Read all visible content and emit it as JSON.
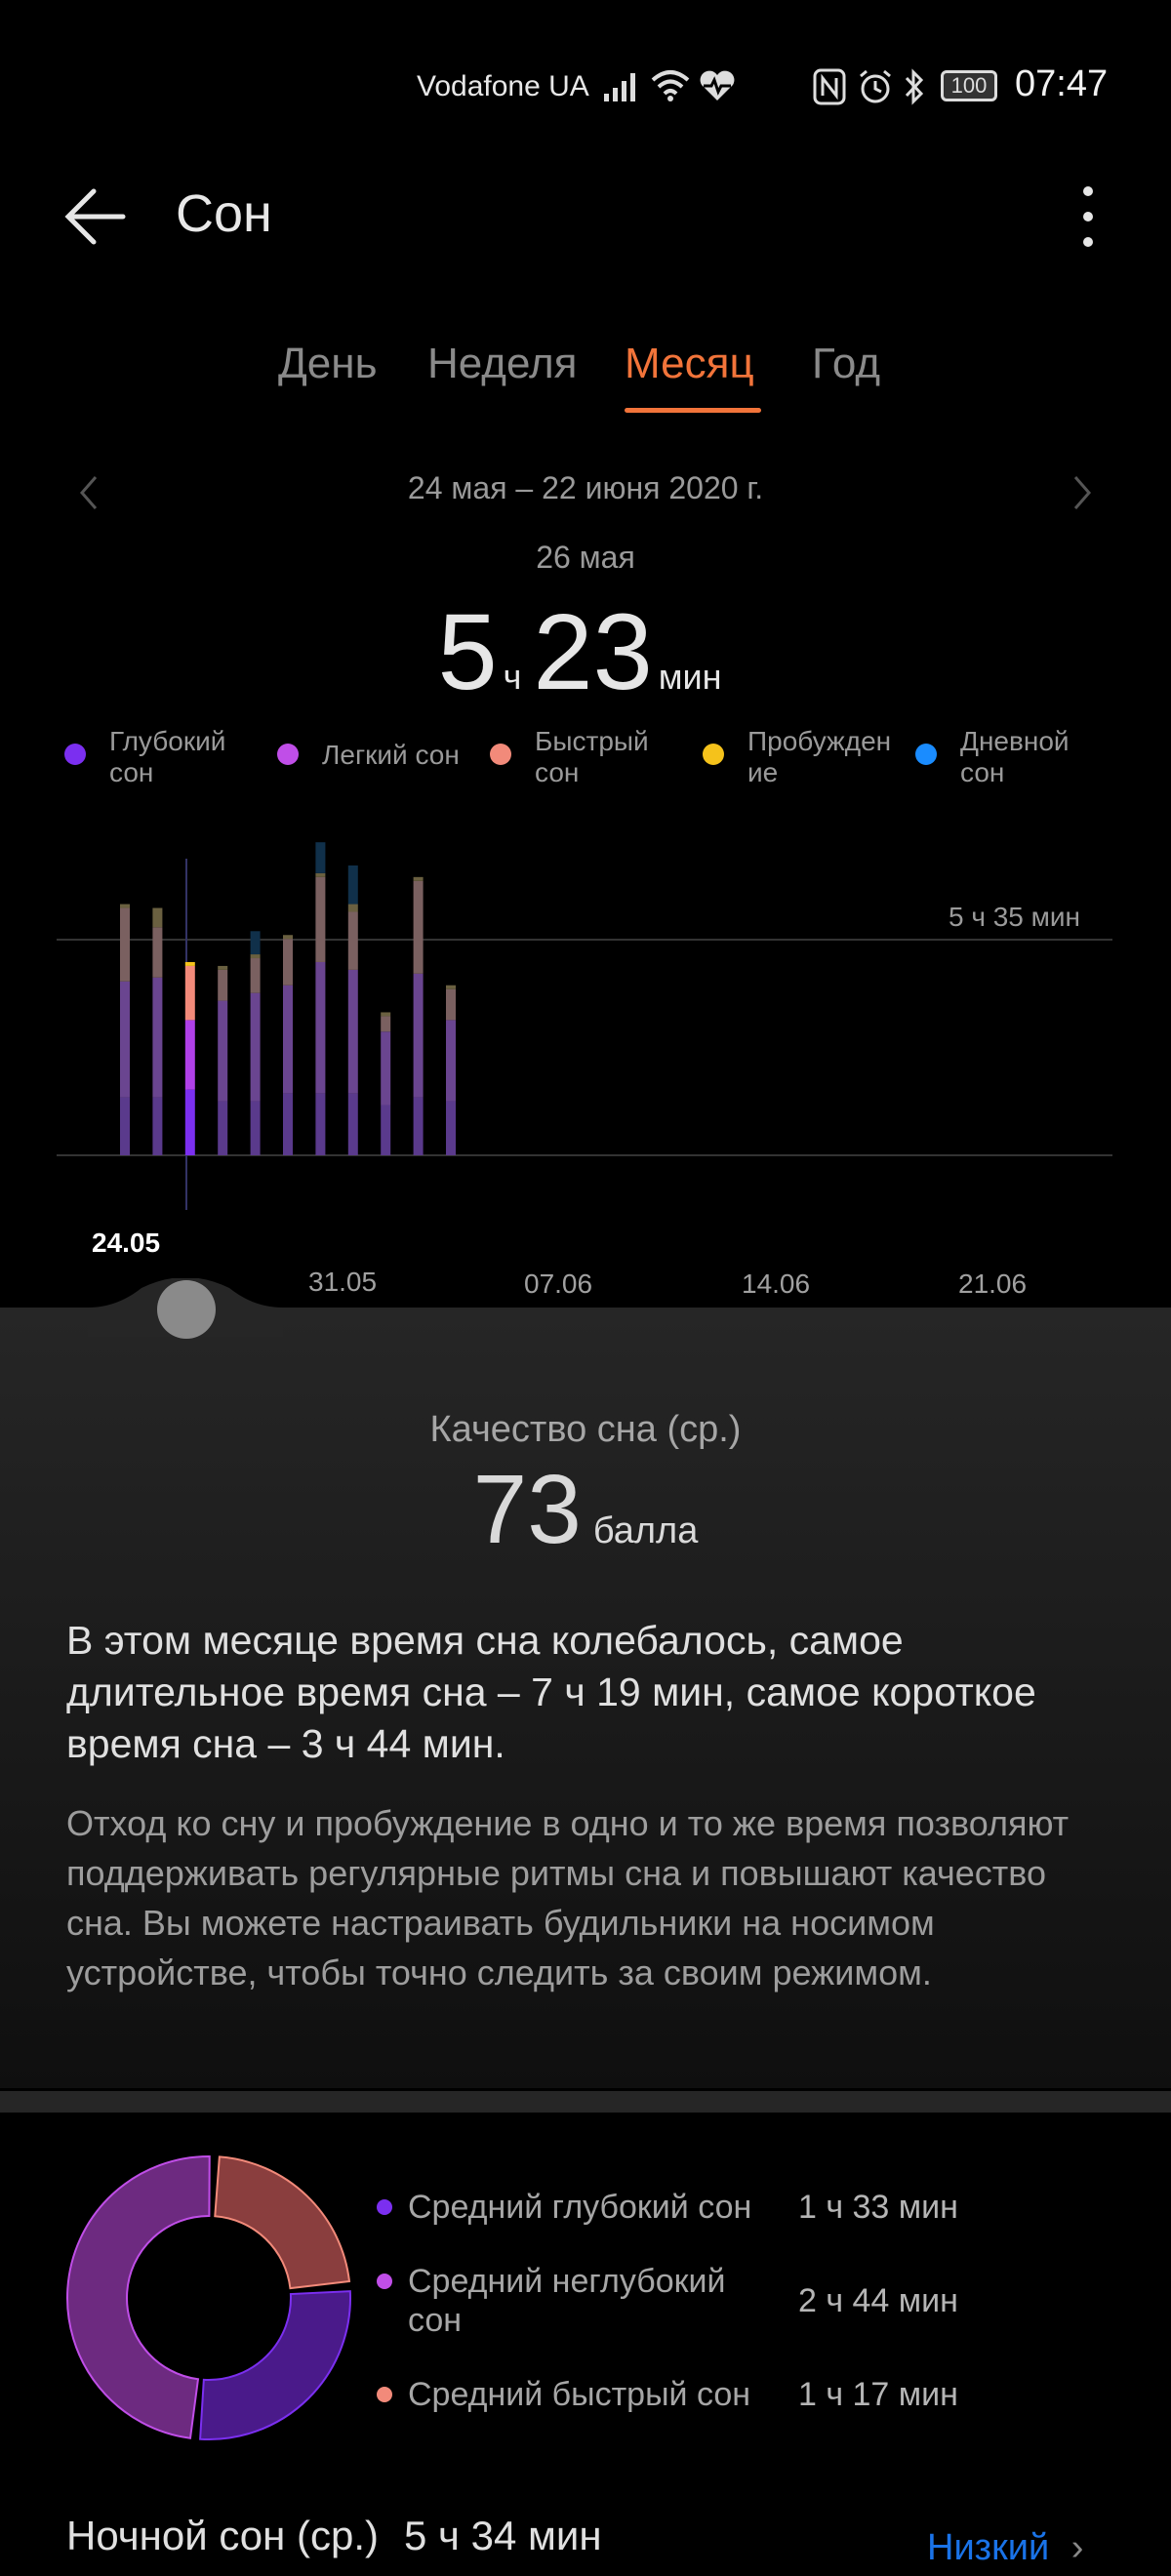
{
  "status_bar": {
    "carrier": "Vodafone UA",
    "battery": "100",
    "time": "07:47",
    "icons": [
      "signal-icon",
      "wifi-icon",
      "heart-rate-icon",
      "nfc-icon",
      "alarm-icon",
      "bluetooth-icon",
      "battery-icon"
    ]
  },
  "header": {
    "title": "Сон"
  },
  "tabs": [
    {
      "label": "День",
      "active": false
    },
    {
      "label": "Неделя",
      "active": false
    },
    {
      "label": "Месяц",
      "active": true
    },
    {
      "label": "Год",
      "active": false
    }
  ],
  "date_range": "24 мая – 22 июня 2020 г.",
  "selected": {
    "date": "26 мая",
    "hours": "5",
    "hours_unit": "ч",
    "minutes": "23",
    "minutes_unit": "мин"
  },
  "legend": [
    {
      "label": "Глубокий\nсон",
      "color": "#7b2ff0"
    },
    {
      "label": "Легкий сон",
      "color": "#c04ee8"
    },
    {
      "label": "Быстрый\nсон",
      "color": "#f28a7a"
    },
    {
      "label": "Пробужден\nие",
      "color": "#f5c21b"
    },
    {
      "label": "Дневной\nсон",
      "color": "#1a8cff"
    }
  ],
  "chart_data": {
    "type": "bar",
    "stacked": true,
    "reference_line": {
      "label": "5 ч 35 мин",
      "value_hours": 5.58
    },
    "x_tick_labels": [
      "24.05",
      "31.05",
      "07.06",
      "14.06",
      "21.06"
    ],
    "selected_index": 2,
    "categories": [
      "24.05",
      "25.05",
      "26.05",
      "27.05",
      "28.05",
      "29.05",
      "30.05",
      "31.05",
      "01.06",
      "02.06",
      "03.06"
    ],
    "series": [
      {
        "name": "Глубокий сон",
        "values": [
          1.5,
          1.5,
          1.7,
          1.4,
          1.4,
          1.6,
          1.6,
          1.6,
          1.3,
          1.5,
          1.4
        ]
      },
      {
        "name": "Легкий сон",
        "values": [
          3.0,
          3.1,
          1.8,
          2.6,
          2.8,
          2.8,
          3.4,
          3.2,
          1.9,
          3.2,
          2.1
        ]
      },
      {
        "name": "Быстрый сон",
        "values": [
          1.9,
          1.3,
          1.4,
          0.8,
          0.9,
          1.2,
          2.2,
          1.5,
          0.4,
          2.4,
          0.8
        ]
      },
      {
        "name": "Пробуждение",
        "values": [
          0.1,
          0.5,
          0.1,
          0.1,
          0.1,
          0.1,
          0.1,
          0.2,
          0.1,
          0.1,
          0.1
        ]
      },
      {
        "name": "Дневной сон",
        "values": [
          0,
          0,
          0,
          0,
          0.6,
          0,
          0.8,
          1.0,
          0,
          0,
          0
        ]
      }
    ],
    "ylim": [
      0,
      8.5
    ],
    "grid": false
  },
  "quality": {
    "title": "Качество сна (ср.)",
    "score": "73",
    "unit": "балла"
  },
  "summary": "В этом месяце время сна колебалось, самое длительное время сна – 7 ч 19 мин, самое короткое время сна – 3 ч 44 мин.",
  "advice": "Отход ко сну и пробуждение в одно и то же время позволяют поддерживать регулярные ритмы сна и повышают качество сна. Вы можете настраивать будильники на носимом устройстве, чтобы точно следить за своим режимом.",
  "averages": [
    {
      "label": "Средний глубокий сон",
      "value": "1 ч 33 мин",
      "color": "#7b2ff0"
    },
    {
      "label": "Средний неглубокий\nсон",
      "value": "2 ч 44 мин",
      "color": "#c04ee8"
    },
    {
      "label": "Средний быстрый сон",
      "value": "1 ч 17 мин",
      "color": "#f28a7a"
    }
  ],
  "donut_data": {
    "type": "pie",
    "slices": [
      {
        "name": "Средний глубокий сон",
        "value": 93
      },
      {
        "name": "Средний неглубокий сон",
        "value": 164
      },
      {
        "name": "Средний быстрый сон",
        "value": 77
      }
    ]
  },
  "night_sleep": {
    "label": "Ночной сон (ср.)",
    "value": "5 ч 34 мин",
    "rating": "Низкий"
  }
}
